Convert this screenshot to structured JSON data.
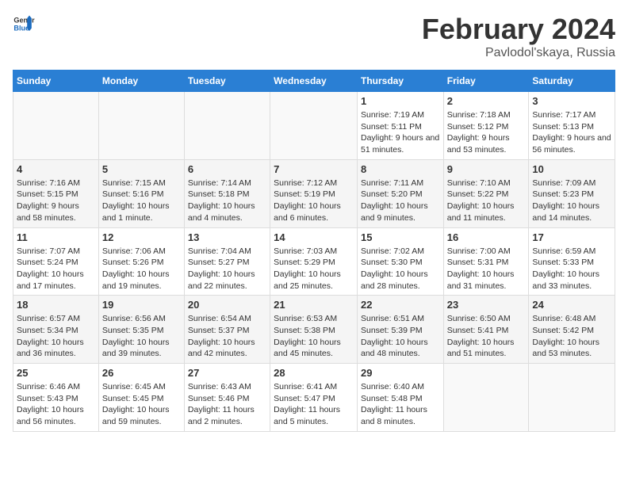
{
  "logo": {
    "text_general": "General",
    "text_blue": "Blue"
  },
  "title": "February 2024",
  "subtitle": "Pavlodol'skaya, Russia",
  "days_of_week": [
    "Sunday",
    "Monday",
    "Tuesday",
    "Wednesday",
    "Thursday",
    "Friday",
    "Saturday"
  ],
  "weeks": [
    [
      {
        "empty": true
      },
      {
        "empty": true
      },
      {
        "empty": true
      },
      {
        "empty": true
      },
      {
        "day": "1",
        "sunrise": "7:19 AM",
        "sunset": "5:11 PM",
        "daylight": "9 hours and 51 minutes."
      },
      {
        "day": "2",
        "sunrise": "7:18 AM",
        "sunset": "5:12 PM",
        "daylight": "9 hours and 53 minutes."
      },
      {
        "day": "3",
        "sunrise": "7:17 AM",
        "sunset": "5:13 PM",
        "daylight": "9 hours and 56 minutes."
      }
    ],
    [
      {
        "day": "4",
        "sunrise": "7:16 AM",
        "sunset": "5:15 PM",
        "daylight": "9 hours and 58 minutes."
      },
      {
        "day": "5",
        "sunrise": "7:15 AM",
        "sunset": "5:16 PM",
        "daylight": "10 hours and 1 minute."
      },
      {
        "day": "6",
        "sunrise": "7:14 AM",
        "sunset": "5:18 PM",
        "daylight": "10 hours and 4 minutes."
      },
      {
        "day": "7",
        "sunrise": "7:12 AM",
        "sunset": "5:19 PM",
        "daylight": "10 hours and 6 minutes."
      },
      {
        "day": "8",
        "sunrise": "7:11 AM",
        "sunset": "5:20 PM",
        "daylight": "10 hours and 9 minutes."
      },
      {
        "day": "9",
        "sunrise": "7:10 AM",
        "sunset": "5:22 PM",
        "daylight": "10 hours and 11 minutes."
      },
      {
        "day": "10",
        "sunrise": "7:09 AM",
        "sunset": "5:23 PM",
        "daylight": "10 hours and 14 minutes."
      }
    ],
    [
      {
        "day": "11",
        "sunrise": "7:07 AM",
        "sunset": "5:24 PM",
        "daylight": "10 hours and 17 minutes."
      },
      {
        "day": "12",
        "sunrise": "7:06 AM",
        "sunset": "5:26 PM",
        "daylight": "10 hours and 19 minutes."
      },
      {
        "day": "13",
        "sunrise": "7:04 AM",
        "sunset": "5:27 PM",
        "daylight": "10 hours and 22 minutes."
      },
      {
        "day": "14",
        "sunrise": "7:03 AM",
        "sunset": "5:29 PM",
        "daylight": "10 hours and 25 minutes."
      },
      {
        "day": "15",
        "sunrise": "7:02 AM",
        "sunset": "5:30 PM",
        "daylight": "10 hours and 28 minutes."
      },
      {
        "day": "16",
        "sunrise": "7:00 AM",
        "sunset": "5:31 PM",
        "daylight": "10 hours and 31 minutes."
      },
      {
        "day": "17",
        "sunrise": "6:59 AM",
        "sunset": "5:33 PM",
        "daylight": "10 hours and 33 minutes."
      }
    ],
    [
      {
        "day": "18",
        "sunrise": "6:57 AM",
        "sunset": "5:34 PM",
        "daylight": "10 hours and 36 minutes."
      },
      {
        "day": "19",
        "sunrise": "6:56 AM",
        "sunset": "5:35 PM",
        "daylight": "10 hours and 39 minutes."
      },
      {
        "day": "20",
        "sunrise": "6:54 AM",
        "sunset": "5:37 PM",
        "daylight": "10 hours and 42 minutes."
      },
      {
        "day": "21",
        "sunrise": "6:53 AM",
        "sunset": "5:38 PM",
        "daylight": "10 hours and 45 minutes."
      },
      {
        "day": "22",
        "sunrise": "6:51 AM",
        "sunset": "5:39 PM",
        "daylight": "10 hours and 48 minutes."
      },
      {
        "day": "23",
        "sunrise": "6:50 AM",
        "sunset": "5:41 PM",
        "daylight": "10 hours and 51 minutes."
      },
      {
        "day": "24",
        "sunrise": "6:48 AM",
        "sunset": "5:42 PM",
        "daylight": "10 hours and 53 minutes."
      }
    ],
    [
      {
        "day": "25",
        "sunrise": "6:46 AM",
        "sunset": "5:43 PM",
        "daylight": "10 hours and 56 minutes."
      },
      {
        "day": "26",
        "sunrise": "6:45 AM",
        "sunset": "5:45 PM",
        "daylight": "10 hours and 59 minutes."
      },
      {
        "day": "27",
        "sunrise": "6:43 AM",
        "sunset": "5:46 PM",
        "daylight": "11 hours and 2 minutes."
      },
      {
        "day": "28",
        "sunrise": "6:41 AM",
        "sunset": "5:47 PM",
        "daylight": "11 hours and 5 minutes."
      },
      {
        "day": "29",
        "sunrise": "6:40 AM",
        "sunset": "5:48 PM",
        "daylight": "11 hours and 8 minutes."
      },
      {
        "empty": true
      },
      {
        "empty": true
      }
    ]
  ],
  "labels": {
    "sunrise": "Sunrise:",
    "sunset": "Sunset:",
    "daylight": "Daylight:"
  }
}
